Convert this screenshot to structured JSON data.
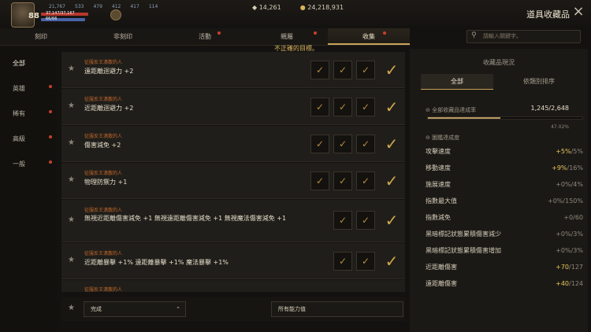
{
  "player": {
    "level": "88",
    "stat1": "21,767",
    "stat2": "533",
    "stat3": "479",
    "stat4": "412",
    "stat5": "417",
    "stat6": "114",
    "hp": "37,147/37,167",
    "mp": "66/66"
  },
  "currency": {
    "crystal": "14,261",
    "gold": "24,218,931"
  },
  "header": {
    "title": "道具收藏品",
    "close": "×"
  },
  "tabs": [
    {
      "label": "刻印"
    },
    {
      "label": "非刻印"
    },
    {
      "label": "活動"
    },
    {
      "label": "親屬"
    },
    {
      "label": "收集"
    }
  ],
  "search": {
    "placeholder": "請輸入關鍵字。"
  },
  "notice": "不正確的目標。",
  "sidebar": {
    "items": [
      {
        "label": "全部"
      },
      {
        "label": "英雄"
      },
      {
        "label": "稀有"
      },
      {
        "label": "高級"
      },
      {
        "label": "一般"
      }
    ]
  },
  "rows": [
    {
      "requirement": "征服反王潰散的人",
      "effect": "遠距離迴避力 +2"
    },
    {
      "requirement": "征服反王潰散的人",
      "effect": "近距離迴避力 +2"
    },
    {
      "requirement": "征服反王潰散的人",
      "effect": "傷害減免 +2"
    },
    {
      "requirement": "征服反王潰散的人",
      "effect": "物理防禦力 +1"
    },
    {
      "requirement": "征服反王潰散的人",
      "effect": "無視近距離傷害減免 +1 無視遠距離傷害減免 +1 無視魔法傷害減免 +1"
    },
    {
      "requirement": "征服反王潰散的人",
      "effect": "近距離暴擊 +1% 遠距離暴擊 +1% 魔法暴擊 +1%"
    },
    {
      "requirement": "征服反王潰散的人",
      "effect": ""
    }
  ],
  "filters": {
    "status": "完成",
    "ability": "所有能力值"
  },
  "panel": {
    "title": "收藏品現況",
    "tabs": {
      "all": "全部",
      "category": "依類別排序"
    },
    "overall_label": "全部收藏品達成率",
    "overall_value": "1,245/2,648",
    "overall_percent": "47.02%",
    "overall_fraction": 0.4702,
    "section_label": "圖鑑達成度",
    "stats": [
      {
        "name": "攻擊速度",
        "cur": "+5%",
        "max": "/5%",
        "up": true
      },
      {
        "name": "移動速度",
        "cur": "+9%",
        "max": "/16%",
        "up": true
      },
      {
        "name": "施展速度",
        "cur": "+0%",
        "max": "/4%",
        "up": false
      },
      {
        "name": "指數最大值",
        "cur": "+0%",
        "max": "/150%",
        "up": false
      },
      {
        "name": "指數減免",
        "cur": "+0",
        "max": "/60",
        "up": false
      },
      {
        "name": "黑暗標記狀態累積傷害減少",
        "cur": "+0%",
        "max": "/3%",
        "up": false
      },
      {
        "name": "黑暗標記狀態累積傷害增加",
        "cur": "+0%",
        "max": "/3%",
        "up": false
      },
      {
        "name": "近距離傷害",
        "cur": "+70",
        "max": "/127",
        "up": true
      },
      {
        "name": "遠距離傷害",
        "cur": "+40",
        "max": "/124",
        "up": true
      }
    ]
  }
}
